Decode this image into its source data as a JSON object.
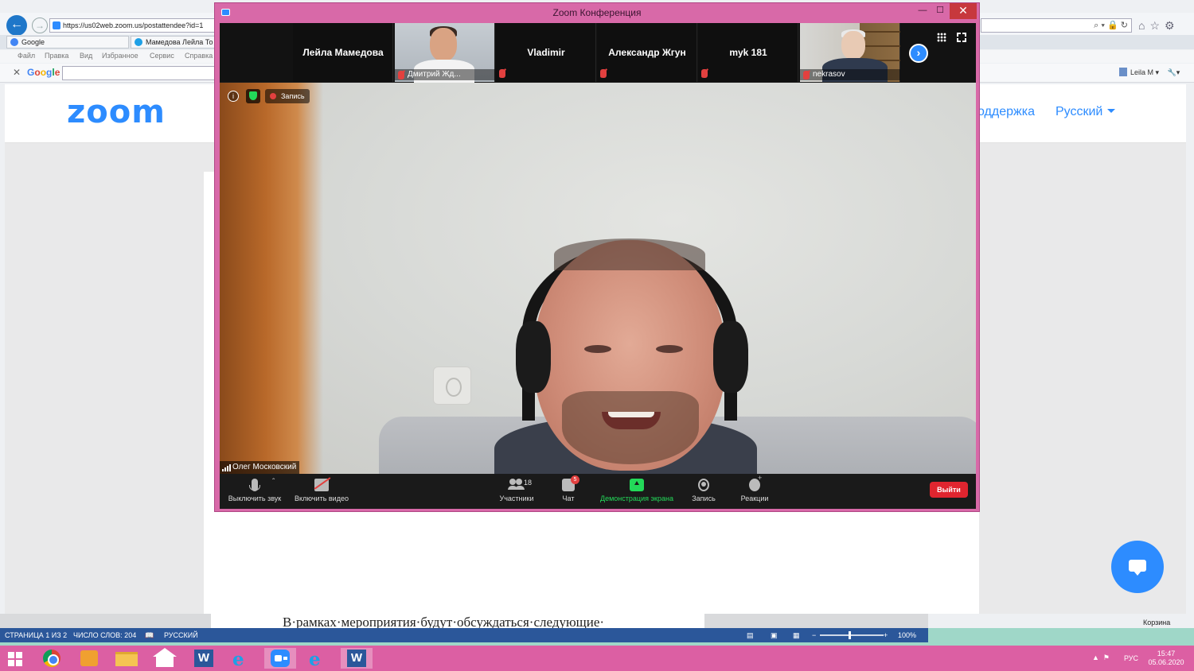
{
  "browser": {
    "address_url": "https://us02web.zoom.us/postattendee?id=1",
    "address_right_icons": "⌕ ▾ 🔒 ↻",
    "tabs": [
      {
        "label": "Google"
      },
      {
        "label": "Мамедова Лейла То"
      }
    ],
    "menu": [
      "Файл",
      "Правка",
      "Вид",
      "Избранное",
      "Сервис",
      "Справка"
    ],
    "google_toolbar_label": "Google",
    "user_label": "Leila M ▾"
  },
  "zoom_site": {
    "logo": "zoom",
    "support_link": "оддержка",
    "language": "Русский"
  },
  "word": {
    "doc_text": "В·рамках·мероприятия·будут·обсуждаться·следующие·",
    "page_status": "СТРАНИЦА 1 ИЗ 2",
    "word_count": "ЧИСЛО СЛОВ: 204",
    "language": "РУССКИЙ",
    "zoom_level": "100%"
  },
  "desktop": {
    "recycle_bin_label": "Корзина"
  },
  "taskbar": {
    "lang": "РУС",
    "time": "15:47",
    "date": "05.06.2020"
  },
  "meeting": {
    "window_title": "Zoom Конференция",
    "gallery": [
      {
        "name": "Лейла Мамедова",
        "video": false
      },
      {
        "name": "Дмитрий Жд...",
        "video": true
      },
      {
        "name": "Vladimir",
        "video": false
      },
      {
        "name": "Александр Жгун",
        "video": false
      },
      {
        "name": "myk 181",
        "video": false
      },
      {
        "name": "nekrasov",
        "video": true
      }
    ],
    "recording_label": "Запись",
    "speaker_name": "Олег Московский",
    "controls": {
      "mute": "Выключить звук",
      "video": "Включить видео",
      "participants": "Участники",
      "participants_count": "18",
      "chat": "Чат",
      "chat_badge": "5",
      "share": "Демонстрация экрана",
      "record": "Запись",
      "reactions": "Реакции",
      "leave": "Выйти"
    }
  },
  "colors": {
    "zoom_blue": "#2d8cff",
    "window_frame": "#d869a8",
    "share_green": "#23d959",
    "leave_red": "#e0252f"
  }
}
